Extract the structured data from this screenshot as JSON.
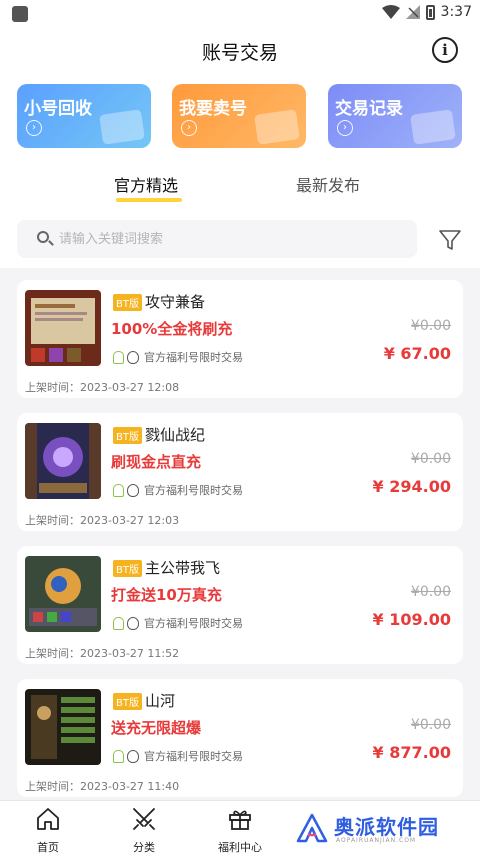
{
  "status_bar": {
    "time": "3:37"
  },
  "header": {
    "title": "账号交易",
    "info_icon": "info-icon"
  },
  "feature_cards": [
    {
      "label": "小号回收",
      "color": "#5aa0ff"
    },
    {
      "label": "我要卖号",
      "color": "#ff9a3c"
    },
    {
      "label": "交易记录",
      "color": "#7c8cf7"
    }
  ],
  "tabs": [
    {
      "label": "官方精选",
      "active": true
    },
    {
      "label": "最新发布",
      "active": false
    }
  ],
  "search": {
    "placeholder": "请输入关键词搜索"
  },
  "listings": [
    {
      "badge": "BT版",
      "name": "攻守兼备",
      "promo": "100%全金将刷充",
      "tag": "官方福利号限时交易",
      "original_price": "¥0.00",
      "price": "¥ 67.00",
      "listed_time": "上架时间：2023-03-27 12:08"
    },
    {
      "badge": "BT版",
      "name": "戮仙战纪",
      "promo": "刷现金点直充",
      "tag": "官方福利号限时交易",
      "original_price": "¥0.00",
      "price": "¥ 294.00",
      "listed_time": "上架时间：2023-03-27 12:03"
    },
    {
      "badge": "BT版",
      "name": "主公带我飞",
      "promo": "打金送10万真充",
      "tag": "官方福利号限时交易",
      "original_price": "¥0.00",
      "price": "¥ 109.00",
      "listed_time": "上架时间：2023-03-27 11:52"
    },
    {
      "badge": "BT版",
      "name": "山河",
      "promo": "送充无限超爆",
      "tag": "官方福利号限时交易",
      "original_price": "¥0.00",
      "price": "¥ 877.00",
      "listed_time": "上架时间：2023-03-27 11:40"
    }
  ],
  "bottom_nav": [
    {
      "label": "首页",
      "icon": "home-icon"
    },
    {
      "label": "分类",
      "icon": "swords-icon"
    },
    {
      "label": "福利中心",
      "icon": "gift-icon"
    }
  ],
  "watermark": {
    "text": "奥派软件园",
    "sub": "AOPAIRUANJIAN.COM"
  }
}
